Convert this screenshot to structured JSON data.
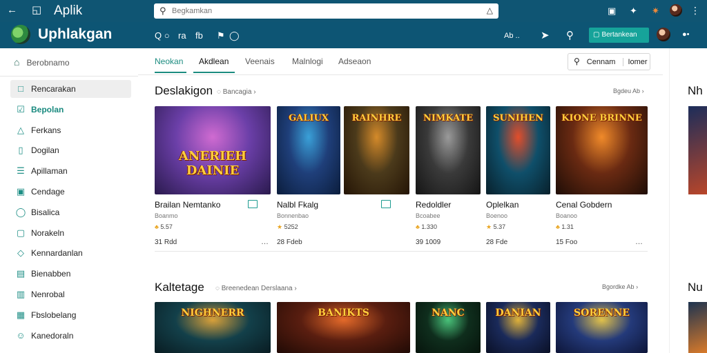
{
  "window": {
    "title": "Aplik"
  },
  "search": {
    "value": "",
    "placeholder": "Begkamkan"
  },
  "brand": {
    "name": "Uphlakgan"
  },
  "subbar": {
    "links": [
      "Q",
      "ra",
      "fb"
    ],
    "right_text": "Ab ..",
    "cta_label": "Bertankean"
  },
  "sidebar": {
    "top_label": "Berobnamo",
    "items": [
      {
        "label": "Rencarakan",
        "icon": "square-icon",
        "state": "selected"
      },
      {
        "label": "Bepolan",
        "icon": "check-box-icon",
        "state": "active"
      },
      {
        "label": "Ferkans",
        "icon": "triangle-icon",
        "state": ""
      },
      {
        "label": "Dogilan",
        "icon": "doc-icon",
        "state": ""
      },
      {
        "label": "Apillaman",
        "icon": "list-icon",
        "state": ""
      },
      {
        "label": "Cendage",
        "icon": "box-icon",
        "state": ""
      },
      {
        "label": "Bisalica",
        "icon": "circle-icon",
        "state": ""
      },
      {
        "label": "Norakeln",
        "icon": "frame-icon",
        "state": ""
      },
      {
        "label": "Kennardanlan",
        "icon": "tag-icon",
        "state": ""
      },
      {
        "label": "Bienabben",
        "icon": "window-icon",
        "state": ""
      },
      {
        "label": "Nenrobal",
        "icon": "folder-icon",
        "state": ""
      },
      {
        "label": "Fbslobelang",
        "icon": "calendar-icon",
        "state": ""
      },
      {
        "label": "Kanedoraln",
        "icon": "person-icon",
        "state": ""
      }
    ]
  },
  "tabs": [
    {
      "label": "Neokan",
      "state": "active"
    },
    {
      "label": "Akdlean",
      "state": "current"
    },
    {
      "label": "Veenais",
      "state": ""
    },
    {
      "label": "Malnlogi",
      "state": ""
    },
    {
      "label": "Adseaon",
      "state": ""
    }
  ],
  "filter": {
    "label": "Cennam",
    "extra": "Iomer"
  },
  "section1": {
    "title": "Deslakigon",
    "sub": "Bancagia",
    "more": "Bgdeu Ab",
    "edge_title": "Nh",
    "cards": [
      {
        "art_text": "ANERIEH DAINIE",
        "title": "Brailan Nemtanko",
        "sub": "Boanmo",
        "rating": "5.57",
        "count": "31 Rdd",
        "has_badge": true,
        "has_star": false,
        "dots": true,
        "c1": "#6b3fa8",
        "c2": "#d06bd1",
        "c3": "#2a1a4d"
      },
      {
        "art_text": "GALIUX",
        "title": "Nalbl Fkalg",
        "sub": "Bonnenbao",
        "rating": "5252",
        "count": "28 Fdeb",
        "has_badge": true,
        "has_star": true,
        "dots": false,
        "c1": "#1f3f7a",
        "c2": "#3aa0d8",
        "c3": "#0b1d3c"
      },
      {
        "art_text": "RAINHRE",
        "title": "",
        "sub": "",
        "rating": "",
        "count": "",
        "has_badge": false,
        "has_star": false,
        "dots": false,
        "c1": "#4b3a1b",
        "c2": "#d48a2a",
        "c3": "#241405"
      },
      {
        "art_text": "NIMKATE",
        "title": "Redoldler",
        "sub": "Bcoabee",
        "rating": "1.330",
        "count": "39 1009",
        "has_badge": false,
        "has_star": false,
        "dots": false,
        "c1": "#3a3a3a",
        "c2": "#9a9a9a",
        "c3": "#151515"
      },
      {
        "art_text": "SUNIHEN",
        "title": "Oplelkan",
        "sub": "Boenoo",
        "rating": "5.37",
        "count": "28 Fde",
        "has_badge": false,
        "has_star": true,
        "dots": false,
        "c1": "#0f4f6a",
        "c2": "#e24e2b",
        "c3": "#08202b"
      },
      {
        "art_text": "KIONE BRINNE",
        "title": "Cenal Gobdern",
        "sub": "Boanoo",
        "rating": "1.31",
        "count": "15 Foo",
        "has_badge": false,
        "has_star": false,
        "dots": true,
        "c1": "#6a2a12",
        "c2": "#f08a2a",
        "c3": "#1e0d06"
      }
    ]
  },
  "section2": {
    "title": "Kaltetage",
    "sub": "Breenedean Derslaana",
    "more": "Bgordke Ab",
    "edge_title": "Nu",
    "cards": [
      {
        "art_text": "NIGHNERR",
        "c1": "#13404a",
        "c2": "#d9a13a",
        "c3": "#091c22"
      },
      {
        "art_text": "BANIKTS",
        "c1": "#5a1e10",
        "c2": "#e46a2a",
        "c3": "#200a05"
      },
      {
        "art_text": "NANC",
        "c1": "#0f2e1d",
        "c2": "#49c27a",
        "c3": "#06140c"
      },
      {
        "art_text": "DANIAN",
        "c1": "#1a2a5a",
        "c2": "#e0b23a",
        "c3": "#0a1026"
      },
      {
        "art_text": "SORENNE",
        "c1": "#243a7a",
        "c2": "#e2c24a",
        "c3": "#0d1538"
      }
    ]
  }
}
